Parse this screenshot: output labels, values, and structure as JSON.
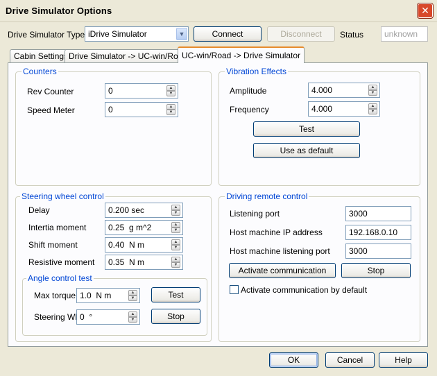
{
  "window": {
    "title": "Drive Simulator Options"
  },
  "top": {
    "type_label": "Drive Simulator Type",
    "type_value": "iDrive Simulator",
    "connect_label": "Connect",
    "disconnect_label": "Disconnect",
    "status_label": "Status",
    "status_value": "unknown"
  },
  "tabs": [
    {
      "label": "Cabin Settings"
    },
    {
      "label": "Drive Simulator -> UC-win/Road"
    },
    {
      "label": "UC-win/Road -> Drive Simulator",
      "active": true
    }
  ],
  "counters": {
    "title": "Counters",
    "rev_label": "Rev Counter",
    "rev_value": "0",
    "speed_label": "Speed Meter",
    "speed_value": "0"
  },
  "vibration": {
    "title": "Vibration Effects",
    "amplitude_label": "Amplitude",
    "amplitude_value": "4.000",
    "frequency_label": "Frequency",
    "frequency_value": "4.000",
    "test_label": "Test",
    "default_label": "Use as default"
  },
  "steering": {
    "title": "Steering wheel control",
    "delay_label": "Delay",
    "delay_value": "0.200 sec",
    "inertia_label": "Intertia moment",
    "inertia_value": "0.25  g m^2",
    "shift_label": "Shift moment",
    "shift_value": "0.40  N m",
    "resistive_label": "Resistive moment",
    "resistive_value": "0.35  N m",
    "angle": {
      "title": "Angle control test",
      "torque_label": "Max torque",
      "torque_value": "1.0  N m",
      "test_label": "Test",
      "wheel_label": "Steering Whe",
      "wheel_value": "0  °",
      "stop_label": "Stop"
    }
  },
  "remote": {
    "title": "Driving remote control",
    "port_label": "Listening port",
    "port_value": "3000",
    "ip_label": "Host machine IP address",
    "ip_value": "192.168.0.10",
    "host_port_label": "Host machine listening port",
    "host_port_value": "3000",
    "activate_label": "Activate communication",
    "stop_label": "Stop",
    "default_check_label": "Activate communication by default",
    "default_checked": false
  },
  "footer": {
    "ok_label": "OK",
    "cancel_label": "Cancel",
    "help_label": "Help"
  }
}
